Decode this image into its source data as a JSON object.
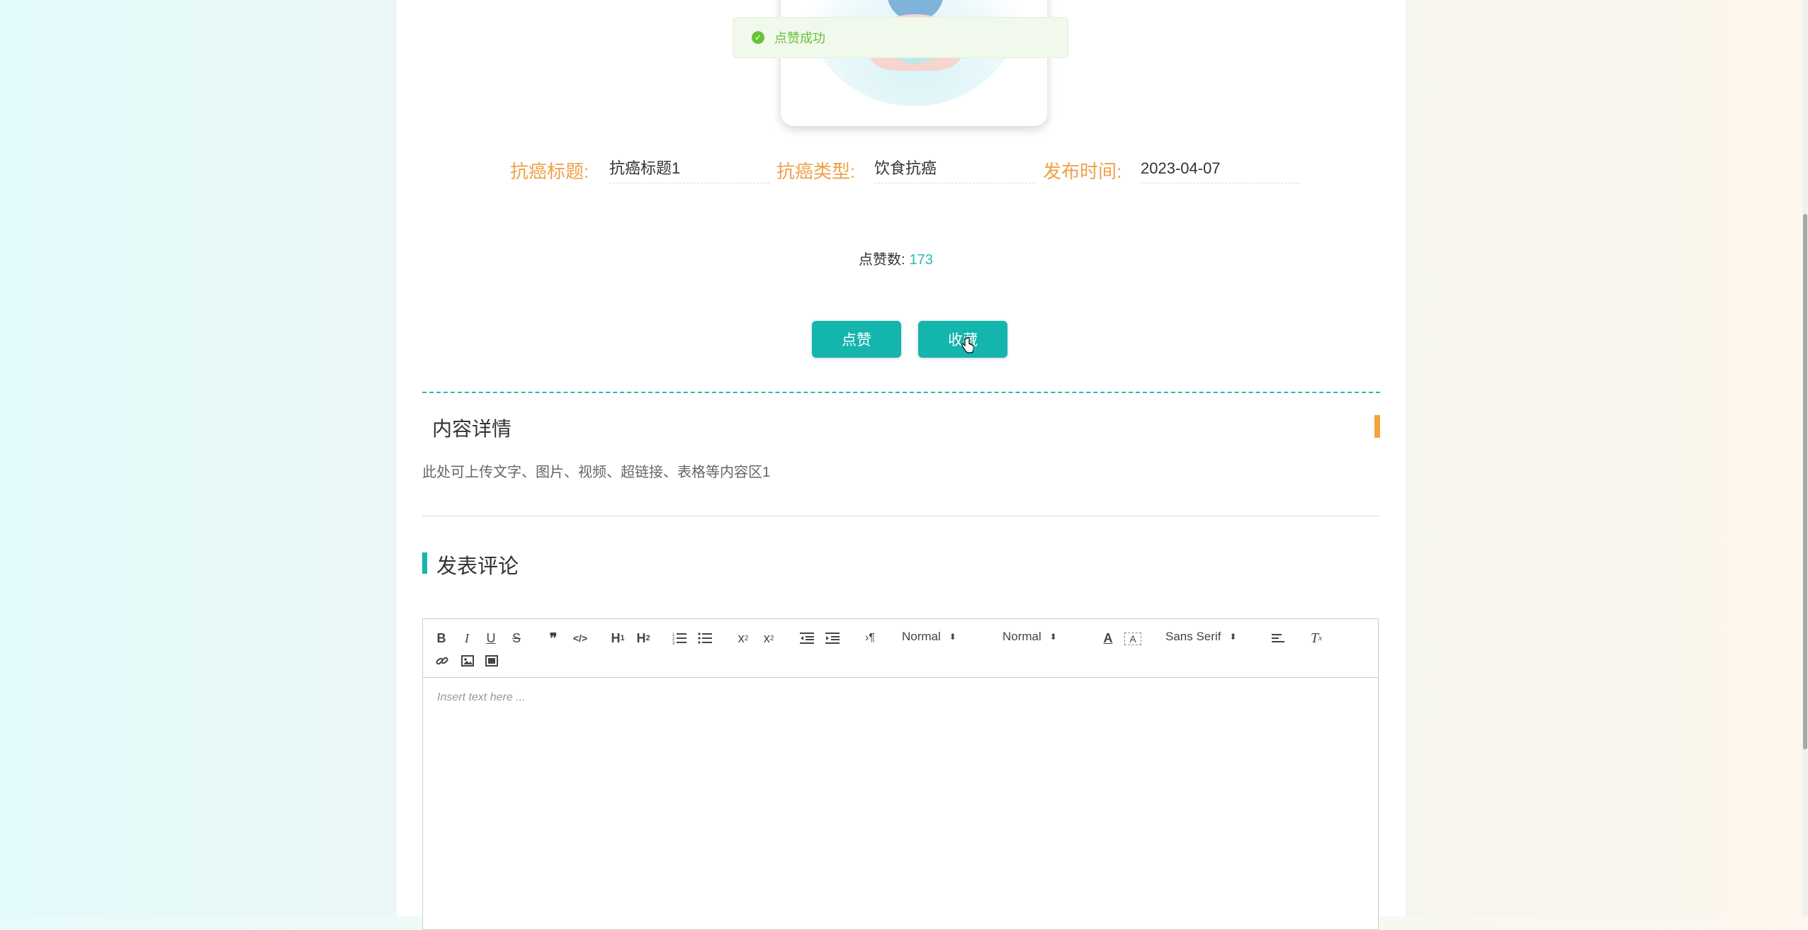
{
  "toast": {
    "message": "点赞成功",
    "icon": "check-circle-icon",
    "color": "#67c23a"
  },
  "fields": [
    {
      "label": "抗癌标题:",
      "value": "抗癌标题1"
    },
    {
      "label": "抗癌类型:",
      "value": "饮食抗癌"
    },
    {
      "label": "发布时间:",
      "value": "2023-04-07"
    }
  ],
  "likes": {
    "label": "点赞数:",
    "count": "173"
  },
  "buttons": {
    "like": "点赞",
    "favorite": "收藏"
  },
  "detail": {
    "title": "内容详情",
    "text": "此处可上传文字、图片、视频、超链接、表格等内容区1"
  },
  "comment": {
    "title": "发表评论",
    "editor": {
      "placeholder": "Insert text here ...",
      "header_select": "Normal",
      "size_select": "Normal",
      "font_select": "Sans Serif",
      "toolbar_icons": [
        "bold-icon",
        "italic-icon",
        "underline-icon",
        "strike-icon",
        "blockquote-icon",
        "code-block-icon",
        "header-1-icon",
        "header-2-icon",
        "ordered-list-icon",
        "bullet-list-icon",
        "subscript-icon",
        "superscript-icon",
        "outdent-icon",
        "indent-icon",
        "rtl-direction-icon",
        "font-color-icon",
        "background-color-icon",
        "align-icon",
        "clean-format-icon",
        "link-icon",
        "image-icon",
        "video-icon"
      ]
    }
  },
  "colors": {
    "accent": "#13b5ad",
    "label_orange": "#f0a049",
    "section_bar_orange": "#f7a23a"
  }
}
